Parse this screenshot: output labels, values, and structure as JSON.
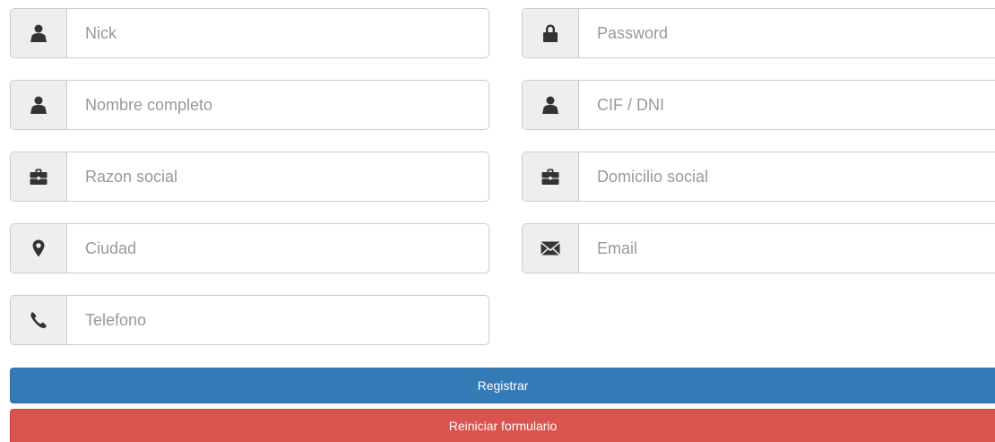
{
  "form": {
    "fields": {
      "nick": {
        "placeholder": "Nick",
        "value": "",
        "icon": "user-icon"
      },
      "password": {
        "placeholder": "Password",
        "value": "",
        "icon": "lock-icon"
      },
      "nombre_completo": {
        "placeholder": "Nombre completo",
        "value": "",
        "icon": "user-icon"
      },
      "cif_dni": {
        "placeholder": "CIF / DNI",
        "value": "",
        "icon": "user-icon"
      },
      "razon_social": {
        "placeholder": "Razon social",
        "value": "",
        "icon": "briefcase-icon"
      },
      "domicilio_social": {
        "placeholder": "Domicilio social",
        "value": "",
        "icon": "briefcase-icon"
      },
      "ciudad": {
        "placeholder": "Ciudad",
        "value": "",
        "icon": "map-marker-icon"
      },
      "email": {
        "placeholder": "Email",
        "value": "",
        "icon": "envelope-icon"
      },
      "telefono": {
        "placeholder": "Telefono",
        "value": "",
        "icon": "phone-icon"
      }
    },
    "buttons": {
      "register_label": "Registrar",
      "reset_label": "Reiniciar formulario"
    }
  },
  "colors": {
    "primary": "#337ab7",
    "danger": "#d9534f",
    "addon_background": "#eeeeee",
    "border": "#cccccc"
  }
}
